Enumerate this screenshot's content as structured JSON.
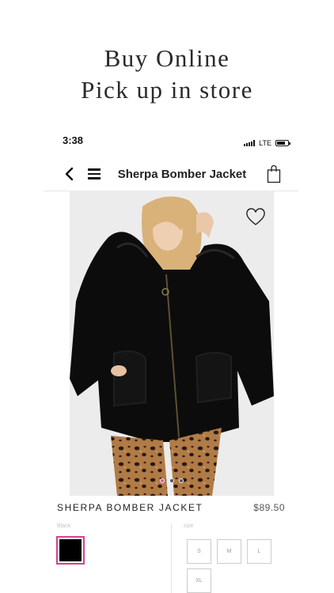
{
  "promo": {
    "line1": "Buy Online",
    "line2": "Pick up in store"
  },
  "status_bar": {
    "time": "3:38",
    "network": "LTE"
  },
  "nav": {
    "back_icon": "chevron-left-icon",
    "menu_icon": "hamburger-menu-icon",
    "title": "Sherpa Bomber Jacket",
    "bag_icon": "shopping-bag-icon"
  },
  "product": {
    "name": "SHERPA BOMBER JACKET",
    "price": "$89.50",
    "favorite_icon": "heart-icon",
    "image_dots": {
      "count": 3,
      "active_index": 0
    },
    "color": {
      "label": "Black",
      "swatch_hex": "#000000",
      "selected_border_hex": "#d6428f"
    },
    "size": {
      "label": "size",
      "options": [
        "S",
        "M",
        "L",
        "XL"
      ]
    }
  }
}
